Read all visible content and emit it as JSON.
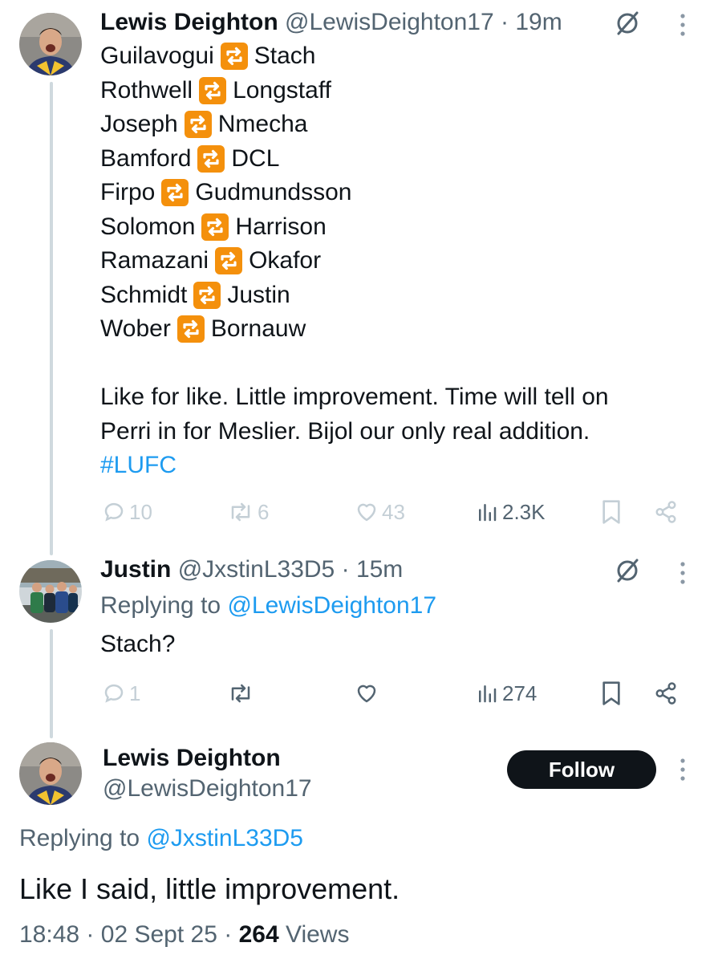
{
  "tweet1": {
    "name": "Lewis Deighton",
    "handle": "@LewisDeighton17",
    "sep": "·",
    "time": "19m",
    "lines": [
      {
        "left": "Guilavogui",
        "right": "Stach"
      },
      {
        "left": "Rothwell",
        "right": "Longstaff"
      },
      {
        "left": "Joseph",
        "right": "Nmecha"
      },
      {
        "left": "Bamford",
        "right": "DCL"
      },
      {
        "left": "Firpo",
        "right": "Gudmundsson"
      },
      {
        "left": "Solomon",
        "right": "Harrison"
      },
      {
        "left": "Ramazani",
        "right": "Okafor"
      },
      {
        "left": "Schmidt",
        "right": "Justin"
      },
      {
        "left": "Wober",
        "right": "Bornauw"
      }
    ],
    "text_line1": "Like for like. Little improvement. Time will tell on",
    "text_line2": "Perri in for Meslier. Bijol our only real addition.",
    "hashtag": "#LUFC",
    "replies": "10",
    "retweets": "6",
    "likes": "43",
    "views": "2.3K",
    "swap_icon": "repeat-button-emoji"
  },
  "tweet2": {
    "name": "Justin",
    "handle": "@JxstinL33D5",
    "sep": "·",
    "time": "15m",
    "replying_label": "Replying to",
    "replying_handle": "@LewisDeighton17",
    "text": "Stach?",
    "replies": "1",
    "views": "274"
  },
  "tweet3": {
    "name": "Lewis Deighton",
    "handle": "@LewisDeighton17",
    "follow_label": "Follow",
    "replying_label": "Replying to",
    "replying_handle": "@JxstinL33D5",
    "text": "Like I said, little improvement.",
    "time": "18:48",
    "sep1": "·",
    "date": "02 Sept 25",
    "sep2": "·",
    "views_count": "264",
    "views_label": "Views"
  },
  "colors": {
    "text": "#0f1419",
    "secondary": "#536471",
    "link": "#1d9bf0",
    "swap_orange": "#f4900c",
    "thread_line": "#cfd9de",
    "follow_bg": "#0f1419"
  }
}
